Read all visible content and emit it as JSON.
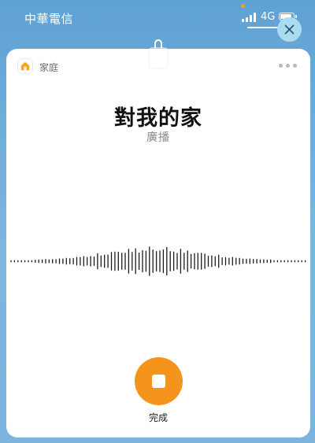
{
  "status_bar": {
    "carrier": "中華電信",
    "network": "4G"
  },
  "card": {
    "home_label": "家庭",
    "title": "對我的家",
    "subtitle": "廣播",
    "done_label": "完成"
  },
  "colors": {
    "accent": "#f5941d",
    "close_button_bg": "#a9dcef",
    "background_top": "#5ea2d4"
  },
  "icons": [
    "home-icon",
    "close-icon",
    "more-icon",
    "stop-icon",
    "lock-icon",
    "signal-icon",
    "battery-icon"
  ]
}
